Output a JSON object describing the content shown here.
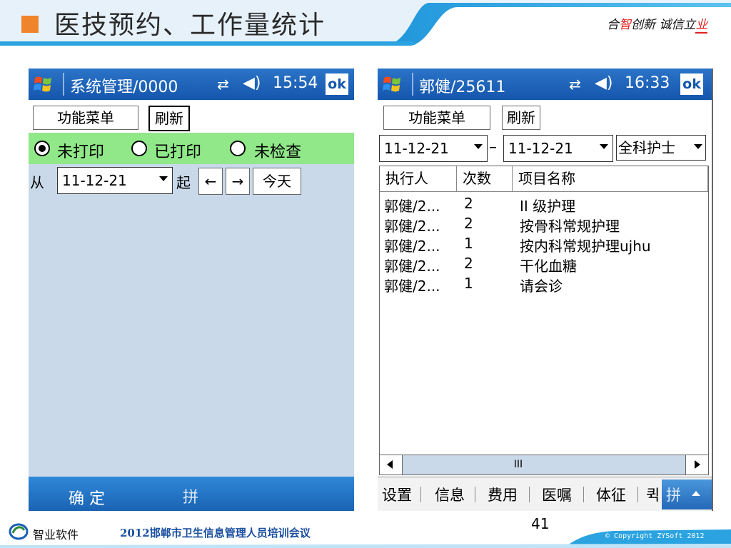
{
  "slide": {
    "title": "医技预约、工作量统计",
    "slogan_parts": [
      "合",
      "智",
      "创新 诚信立",
      "业"
    ],
    "page_number": "41"
  },
  "footer": {
    "company": "智业软件",
    "event": "2012邯郸市卫生信息管理人员培训会议",
    "copyright": "© Copyright ZYSoft 2012"
  },
  "left_phone": {
    "title": "系统管理/0000",
    "time": "15:54",
    "ok_label": "ok",
    "menu_button": "功能菜单",
    "refresh_button": "刷新",
    "radios": [
      {
        "label": "未打印",
        "selected": true
      },
      {
        "label": "已打印",
        "selected": false
      },
      {
        "label": "未检查",
        "selected": false
      }
    ],
    "from_label": "从",
    "date_value": "11-12-21",
    "start_label": "起",
    "prev_label": "←",
    "next_label": "→",
    "today_label": "今天",
    "confirm_label": "确 定",
    "input_method_label": "拼"
  },
  "right_phone": {
    "title": "郭健/25611",
    "time": "16:33",
    "ok_label": "ok",
    "menu_button": "功能菜单",
    "refresh_button": "刷新",
    "date_from": "11-12-21",
    "date_sep": "–",
    "date_to": "11-12-21",
    "role_value": "全科护士",
    "columns": [
      "执行人",
      "次数",
      "项目名称"
    ],
    "rows": [
      [
        "郭健/2...",
        "2",
        "II 级护理"
      ],
      [
        "郭健/2...",
        "2",
        "按骨科常规护理"
      ],
      [
        "郭健/2...",
        "1",
        "按内科常规护理ujhu"
      ],
      [
        "郭健/2...",
        "2",
        "干化血糖"
      ],
      [
        "郭健/2...",
        "1",
        "请会诊"
      ]
    ],
    "scroll_thumb": "III",
    "tabs": [
      "设置",
      "信息",
      "费用",
      "医嘱",
      "体征",
      "퀵"
    ],
    "input_method_label": "拼"
  },
  "colors": {
    "title_bar": "#1556ad",
    "radio_band": "#90e888",
    "accent_orange": "#f0842a",
    "header_blue": "#2aa3e0"
  }
}
